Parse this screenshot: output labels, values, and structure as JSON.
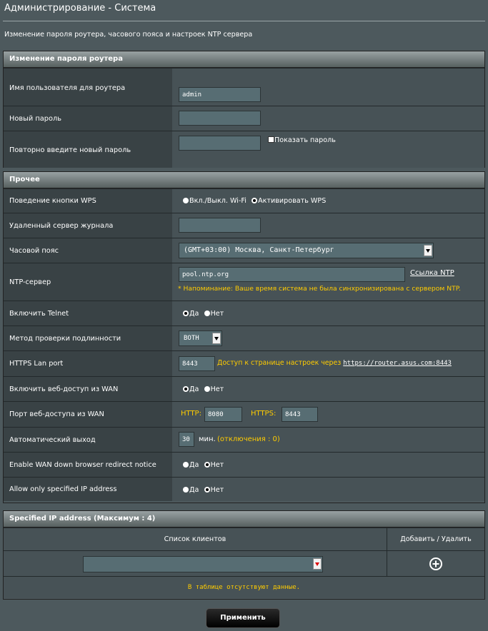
{
  "header": {
    "title": "Администрирование - Система",
    "description": "Изменение пароля роутера, часового пояса и настроек NTP сервера"
  },
  "password_section": {
    "title": "Изменение пароля роутера",
    "username_label": "Имя пользователя для роутера",
    "username_value": "admin",
    "new_password_label": "Новый пароль",
    "confirm_password_label": "Повторно введите новый пароль",
    "show_password_label": "Показать пароль"
  },
  "misc_section": {
    "title": "Прочее",
    "wps_label": "Поведение кнопки WPS",
    "wps_option1": "Вкл./Выкл. Wi-Fi",
    "wps_option2": "Активировать WPS",
    "remote_log_label": "Удаленный сервер журнала",
    "timezone_label": "Часовой пояс",
    "timezone_value": "(GMT+03:00) Москва, Санкт-Петербург",
    "ntp_label": "NTP-сервер",
    "ntp_value": "pool.ntp.org",
    "ntp_link": "Ссылка NTP",
    "ntp_reminder": "* Напоминание: Ваше время система не была синхронизирована с сервером NTP.",
    "telnet_label": "Включить Telnet",
    "yes": "Да",
    "no": "Нет",
    "auth_label": "Метод проверки подлинности",
    "auth_value": "BOTH",
    "https_port_label": "HTTPS Lan port",
    "https_port_value": "8443",
    "https_access_text": "Доступ к странице настроек через",
    "https_access_url": "https://router.asus.com:8443",
    "wan_access_label": "Включить веб-доступ из WAN",
    "wan_port_label": "Порт веб-доступа из WAN",
    "http_label": "HTTP:",
    "http_value": "8080",
    "https_label": "HTTPS:",
    "https_value": "8443",
    "autologout_label": "Автоматический выход",
    "autologout_value": "30",
    "autologout_unit": "мин.",
    "autologout_note": "(отключения : 0)",
    "wan_redirect_label": "Enable WAN down browser redirect notice",
    "allow_ip_label": "Allow only specified IP address"
  },
  "ip_section": {
    "title": "Specified IP address (Максимум : 4)",
    "col_clients": "Список клиентов",
    "col_action": "Добавить / Удалить",
    "empty_text": "В таблице отсутствуют данные."
  },
  "apply_label": "Применить"
}
